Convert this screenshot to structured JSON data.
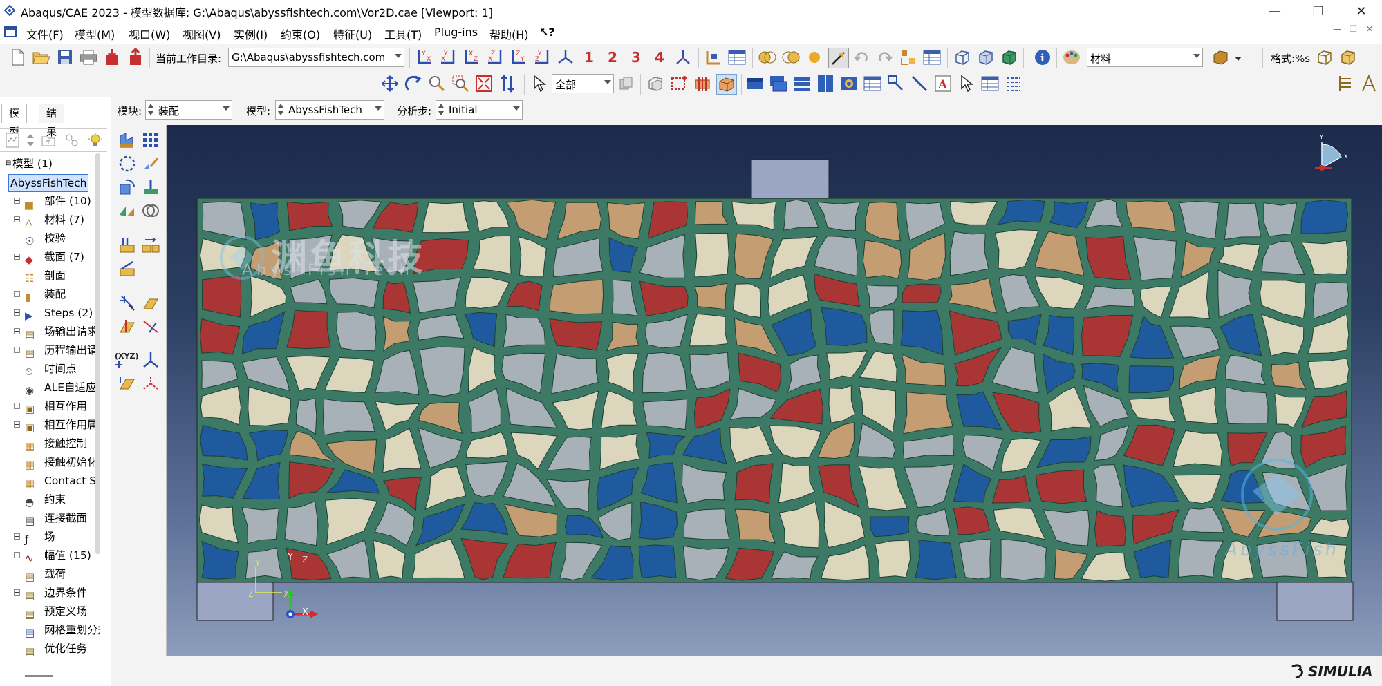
{
  "window": {
    "title": "Abaqus/CAE 2023 - 模型数据库: G:\\Abaqus\\abyssfishtech.com\\Vor2D.cae [Viewport: 1]"
  },
  "menu": [
    "文件(F)",
    "模型(M)",
    "视口(W)",
    "视图(V)",
    "实例(I)",
    "约束(O)",
    "特征(U)",
    "工具(T)",
    "Plug-ins",
    "帮助(H)",
    "↖?"
  ],
  "toolbar": {
    "workdir_label": "当前工作目录:",
    "workdir_value": "G:\\Abaqus\\abyssfishtech.com",
    "view_numbers": [
      "1",
      "2",
      "3",
      "4"
    ],
    "material_select": "材料",
    "format_label": "格式:%s",
    "selection_filter": "全部"
  },
  "context": {
    "module_label": "模块:",
    "module_value": "装配",
    "model_label": "模型:",
    "model_value": "AbyssFishTech",
    "step_label": "分析步:",
    "step_value": "Initial"
  },
  "tabs": [
    "模型",
    "结果"
  ],
  "tree": {
    "root": "模型 (1)",
    "model_name": "AbyssFishTech",
    "items": [
      {
        "label": "部件 (10)",
        "expand": true
      },
      {
        "label": "材料 (7)",
        "expand": true
      },
      {
        "label": "校验",
        "expand": false
      },
      {
        "label": "截面 (7)",
        "expand": true
      },
      {
        "label": "剖面",
        "expand": false
      },
      {
        "label": "装配",
        "expand": true
      },
      {
        "label": "Steps (2)",
        "expand": true
      },
      {
        "label": "场输出请求",
        "expand": true
      },
      {
        "label": "历程输出请求",
        "expand": true
      },
      {
        "label": "时间点",
        "expand": false
      },
      {
        "label": "ALE自适应网格约束",
        "expand": false
      },
      {
        "label": "相互作用",
        "expand": true
      },
      {
        "label": "相互作用属性",
        "expand": true
      },
      {
        "label": "接触控制",
        "expand": false
      },
      {
        "label": "接触初始化",
        "expand": false
      },
      {
        "label": "Contact Stabilizations",
        "expand": false
      },
      {
        "label": "约束",
        "expand": false
      },
      {
        "label": "连接截面",
        "expand": false
      },
      {
        "label": "场",
        "expand": true
      },
      {
        "label": "幅值 (15)",
        "expand": true
      },
      {
        "label": "载荷",
        "expand": false
      },
      {
        "label": "边界条件",
        "expand": true
      },
      {
        "label": "预定义场",
        "expand": false
      },
      {
        "label": "网格重划分规则",
        "expand": false
      },
      {
        "label": "优化任务",
        "expand": false
      }
    ]
  },
  "viewport": {
    "watermark_cn": "渊鱼科技",
    "watermark_en": "AbyssFish Tech",
    "watermark_corner": "AbyssFish",
    "triad": {
      "x": "X",
      "y": "Y",
      "z": "Z"
    },
    "colors": {
      "matrix": "#3d7a66",
      "grain_gray": "#a9b1b8",
      "grain_cream": "#dcd6bd",
      "grain_tan": "#c49d72",
      "grain_blue": "#1f5a9e",
      "grain_red": "#aa3535",
      "support": "#9aa6c4"
    }
  },
  "brand": "SIMULIA"
}
